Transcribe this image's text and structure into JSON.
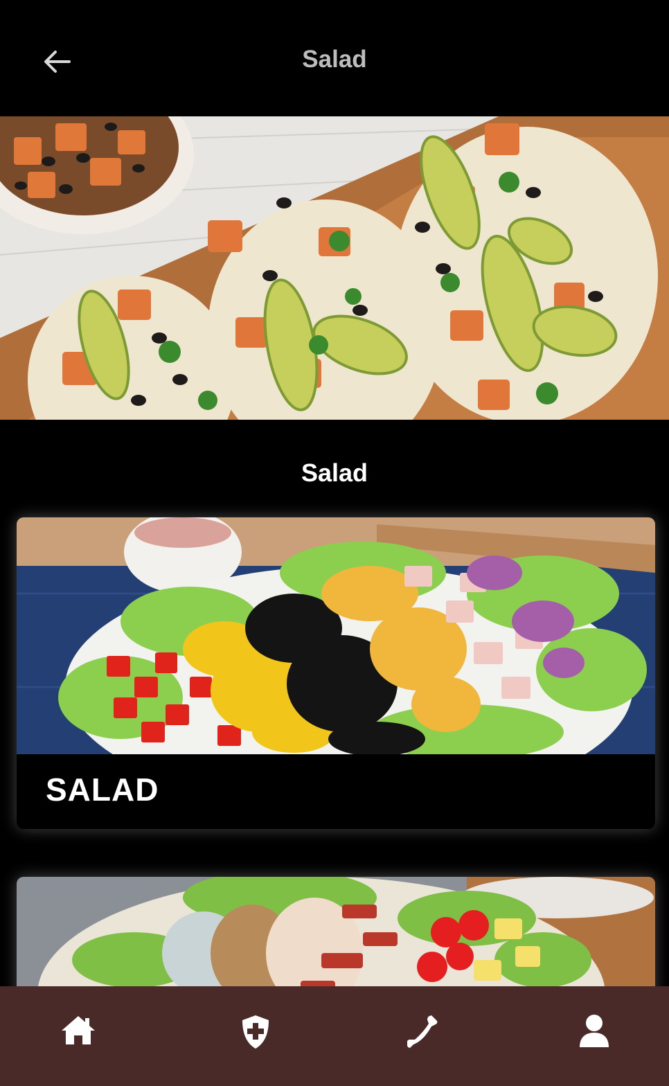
{
  "header": {
    "title": "Salad",
    "back_icon": "arrow-left-icon"
  },
  "hero": {
    "image": "tacos-with-avocado-sweet-potato-black-beans"
  },
  "section": {
    "title": "Salad"
  },
  "cards": [
    {
      "label": "SALAD",
      "image": "cobb-salad-tomato-corn-beans-cheese-ham-onion"
    },
    {
      "label": "",
      "image": "cobb-salad-blue-cheese-walnuts-chicken-bacon-tomato-egg"
    }
  ],
  "bottom_nav": {
    "items": [
      {
        "icon": "home-icon"
      },
      {
        "icon": "shield-plus-icon"
      },
      {
        "icon": "phone-icon"
      },
      {
        "icon": "user-icon"
      }
    ],
    "background": "#4a2a28"
  },
  "colors": {
    "background": "#000000",
    "title_gray": "#bdbdbd",
    "text_white": "#ffffff"
  }
}
